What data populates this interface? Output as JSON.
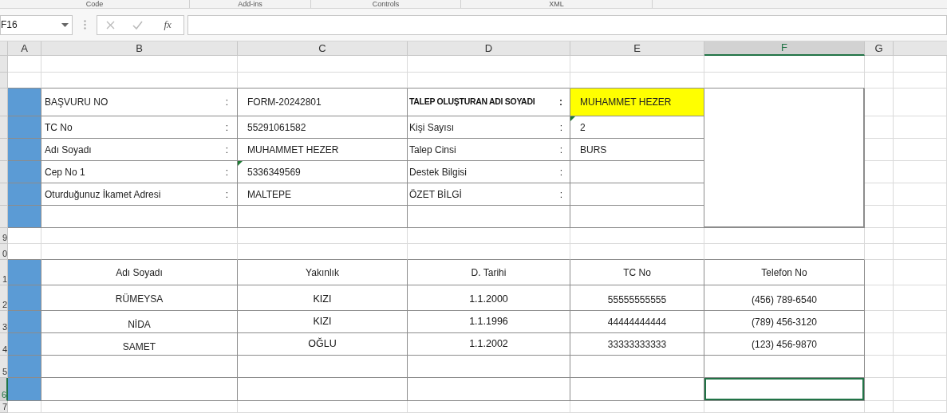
{
  "ribbon_groups": [
    "Code",
    "Add-ins",
    "Controls",
    "XML"
  ],
  "name_box": "F16",
  "formula_bar": {
    "function_label": "fx"
  },
  "columns": [
    {
      "label": "A",
      "selected": false
    },
    {
      "label": "B",
      "selected": false
    },
    {
      "label": "C",
      "selected": false
    },
    {
      "label": "D",
      "selected": false
    },
    {
      "label": "E",
      "selected": false
    },
    {
      "label": "F",
      "selected": true
    },
    {
      "label": "G",
      "selected": false
    }
  ],
  "rows": [
    {
      "selected": false
    },
    {
      "selected": false
    },
    {
      "selected": false
    },
    {
      "selected": false
    },
    {
      "selected": false
    },
    {
      "selected": false
    },
    {
      "selected": false
    },
    {
      "selected": false
    },
    {
      "label": "9",
      "selected": false
    },
    {
      "label": "0",
      "selected": false
    },
    {
      "label": "1",
      "selected": false
    },
    {
      "label": "2",
      "selected": false
    },
    {
      "label": "3",
      "selected": false
    },
    {
      "label": "4",
      "selected": false
    },
    {
      "label": "5",
      "selected": false
    },
    {
      "label": "6",
      "selected": true
    },
    {
      "label": "7",
      "selected": false
    }
  ],
  "form": {
    "left": [
      {
        "label": "BAŞVURU NO",
        "colon": ":",
        "value": "FORM-20242801",
        "error_marker": false
      },
      {
        "label": "TC No",
        "colon": ":",
        "value": "55291061582",
        "error_marker": false
      },
      {
        "label": "Adı Soyadı",
        "colon": ":",
        "value": "MUHAMMET HEZER",
        "error_marker": false
      },
      {
        "label": "Cep No 1",
        "colon": ":",
        "value": "5336349569",
        "error_marker": true
      },
      {
        "label": "Oturduğunuz İkamet Adresi",
        "colon": ":",
        "value": "MALTEPE",
        "error_marker": false
      }
    ],
    "right": [
      {
        "label": "TALEP OLUŞTURAN ADI SOYADI",
        "colon": ":",
        "value": "MUHAMMET HEZER",
        "bold": true,
        "highlighted": true,
        "error_marker": false
      },
      {
        "label": "Kişi Sayısı",
        "colon": ":",
        "value": "2",
        "bold": false,
        "highlighted": false,
        "error_marker": true
      },
      {
        "label": "Talep Cinsi",
        "colon": ":",
        "value": "BURS",
        "bold": false,
        "highlighted": false,
        "error_marker": false
      },
      {
        "label": "Destek Bilgisi",
        "colon": ":",
        "bold": false,
        "highlighted": false,
        "error_marker": false
      },
      {
        "label": "ÖZET BİLGİ",
        "colon": ":",
        "bold": false,
        "highlighted": false,
        "error_marker": false
      }
    ]
  },
  "family_table": {
    "columns": [
      "Adı Soyadı",
      "Yakınlık",
      "D. Tarihi",
      "TC No",
      "Telefon No"
    ],
    "rows": [
      [
        "RÜMEYSA",
        "KIZI",
        "1.1.2000",
        "55555555555",
        "(456) 789-6540"
      ],
      [
        "NİDA",
        "KIZI",
        "1.1.1996",
        "44444444444",
        "(789) 456-3120"
      ],
      [
        "SAMET",
        "OĞLU",
        "1.1.2002",
        "33333333333",
        "(123) 456-9870"
      ]
    ]
  }
}
